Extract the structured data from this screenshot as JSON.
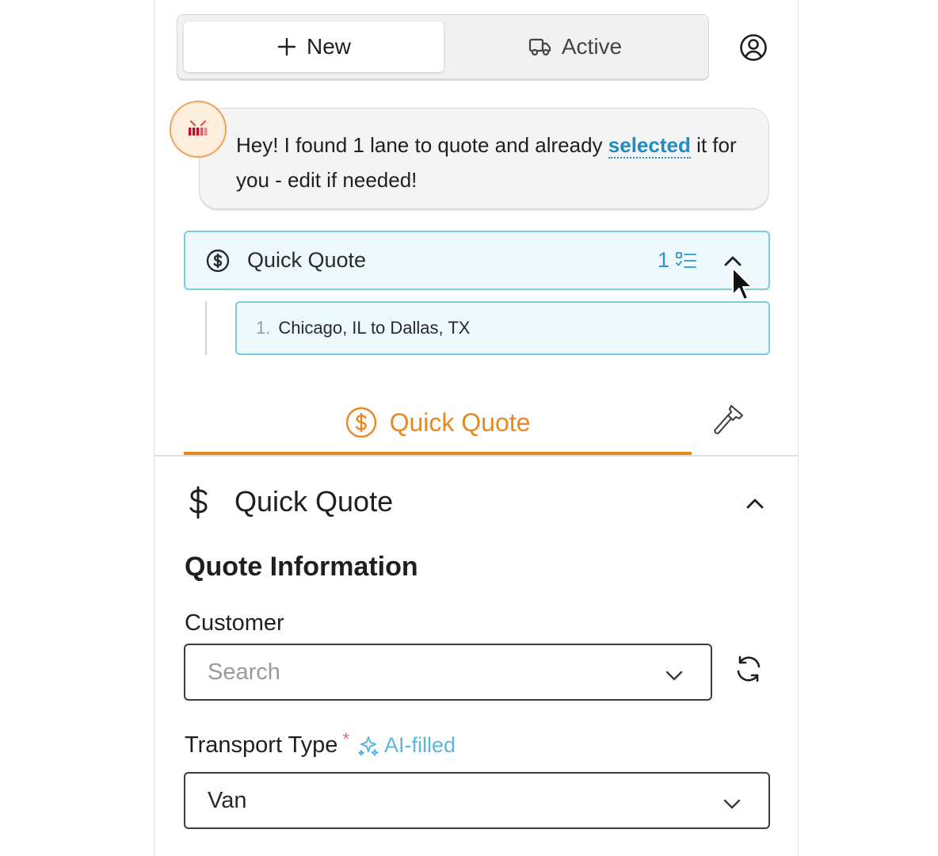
{
  "tabs": {
    "new_label": "New",
    "active_label": "Active"
  },
  "chat": {
    "message_before": "Hey! I found 1 lane to quote and already ",
    "message_link": "selected",
    "message_after": " it for you - edit if needed!"
  },
  "quick_quote_panel": {
    "title": "Quick Quote",
    "lane_count": "1",
    "lanes": [
      {
        "number": "1.",
        "text": "Chicago, IL to Dallas, TX"
      }
    ]
  },
  "tool_tabs": {
    "active_label": "Quick Quote"
  },
  "section": {
    "title": "Quick Quote",
    "subtitle": "Quote Information",
    "customer_label": "Customer",
    "customer_placeholder": "Search",
    "transport_label": "Transport Type",
    "required_mark": "*",
    "ai_badge": "AI-filled",
    "transport_value": "Van"
  },
  "colors": {
    "accent_orange": "#e8891f",
    "accent_blue": "#2b97c6",
    "panel_border_blue": "#7ccbe4",
    "ai_blue": "#5bb6dd",
    "required_red": "#e26a6a"
  },
  "icons": [
    "plus-icon",
    "truck-icon",
    "user-circle-icon",
    "bot-avatar-icon",
    "dollar-circle-icon",
    "checklist-icon",
    "chevron-up-icon",
    "hammer-icon",
    "dollar-icon",
    "chevron-down-icon",
    "refresh-icon",
    "sparkle-icon",
    "cursor-icon"
  ]
}
